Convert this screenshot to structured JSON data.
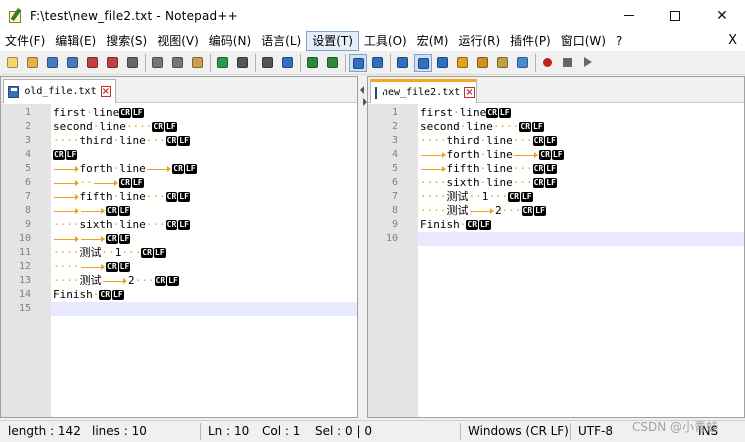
{
  "window": {
    "title": "F:\\test\\new_file2.txt - Notepad++",
    "controls": {
      "minimize": "minimize-icon",
      "maximize": "maximize-icon",
      "close": "✕"
    }
  },
  "menu": {
    "items": [
      "文件(F)",
      "编辑(E)",
      "搜索(S)",
      "视图(V)",
      "编码(N)",
      "语言(L)",
      "设置(T)",
      "工具(O)",
      "宏(M)",
      "运行(R)",
      "插件(P)",
      "窗口(W)",
      "?"
    ],
    "active_index": 6,
    "close_doc": "X"
  },
  "toolbar": {
    "icons": [
      "new-file-icon",
      "open-file-icon",
      "save-icon",
      "save-all-icon",
      "close-icon",
      "close-all-icon",
      "print-icon",
      "cut-icon",
      "copy-icon",
      "paste-icon",
      "undo-icon",
      "redo-icon",
      "find-icon",
      "replace-icon",
      "zoom-in-icon",
      "zoom-out-icon",
      "sync-vertical-icon",
      "sync-horizontal-icon",
      "word-wrap-icon",
      "show-all-chars-icon",
      "indent-guide-icon",
      "doc-map-icon",
      "function-list-icon",
      "folder-workspace-icon",
      "monitor-icon",
      "record-macro-icon",
      "stop-record-icon",
      "play-macro-icon"
    ],
    "pressed": [
      "sync-vertical-icon",
      "show-all-chars-icon"
    ]
  },
  "left_pane": {
    "tab_label": "old_file.txt",
    "lines": [
      {
        "num": "1",
        "text": "first·line",
        "eol": true
      },
      {
        "num": "2",
        "text": "second·line····",
        "eol": true
      },
      {
        "num": "3",
        "text": "····third·line···",
        "eol": true
      },
      {
        "num": "4",
        "text": "",
        "eol": true
      },
      {
        "num": "5",
        "text": "\tforth·line\t",
        "eol": true
      },
      {
        "num": "6",
        "text": "\t··\t",
        "eol": true
      },
      {
        "num": "7",
        "text": "\tfifth·line···",
        "eol": true
      },
      {
        "num": "8",
        "text": "\t\t",
        "eol": true
      },
      {
        "num": "9",
        "text": "····sixth·line···",
        "eol": true
      },
      {
        "num": "10",
        "text": "\t\t",
        "eol": true
      },
      {
        "num": "11",
        "text": "····测试··1···",
        "eol": true
      },
      {
        "num": "12",
        "text": "····\t",
        "eol": true
      },
      {
        "num": "13",
        "text": "····测试\t2···",
        "eol": true
      },
      {
        "num": "14",
        "text": "Finish·",
        "eol": true
      },
      {
        "num": "15",
        "text": "",
        "eol": false
      }
    ]
  },
  "right_pane": {
    "tab_label": "new_file2.txt",
    "lines": [
      {
        "num": "1",
        "text": "first·line",
        "eol": true
      },
      {
        "num": "2",
        "text": "second·line····",
        "eol": true
      },
      {
        "num": "3",
        "text": "····third·line···",
        "eol": true
      },
      {
        "num": "4",
        "text": "\tforth·line\t",
        "eol": true
      },
      {
        "num": "5",
        "text": "\tfifth·line···",
        "eol": true
      },
      {
        "num": "6",
        "text": "····sixth·line···",
        "eol": true
      },
      {
        "num": "7",
        "text": "····测试··1···",
        "eol": true
      },
      {
        "num": "8",
        "text": "····测试\t2···",
        "eol": true
      },
      {
        "num": "9",
        "text": "Finish·",
        "eol": true
      },
      {
        "num": "10",
        "text": "",
        "eol": false
      }
    ]
  },
  "eol_marks": {
    "cr": "CR",
    "lf": "LF"
  },
  "status": {
    "length": "length : 142",
    "lines": "lines : 10",
    "ln": "Ln : 10",
    "col": "Col : 1",
    "sel": "Sel : 0 | 0",
    "eol_mode": "Windows (CR LF)",
    "encoding": "UTF-8",
    "ins": "INS"
  },
  "watermark": "CSDN @小青蛙"
}
